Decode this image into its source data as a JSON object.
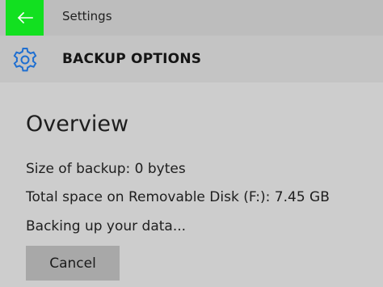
{
  "titlebar": {
    "title": "Settings",
    "back_icon": "back-arrow-icon"
  },
  "header": {
    "icon": "gear-icon",
    "title": "BACKUP OPTIONS"
  },
  "main": {
    "heading": "Overview",
    "size_line": "Size of backup: 0 bytes",
    "space_line": "Total space on Removable Disk (F:): 7.45 GB",
    "status_line": "Backing up your data...",
    "cancel_label": "Cancel"
  },
  "colors": {
    "back_button_highlight": "#12e020",
    "gear_icon": "#1f6fd1",
    "background": "#cdcdcd",
    "button_background": "#a8a8a8"
  }
}
